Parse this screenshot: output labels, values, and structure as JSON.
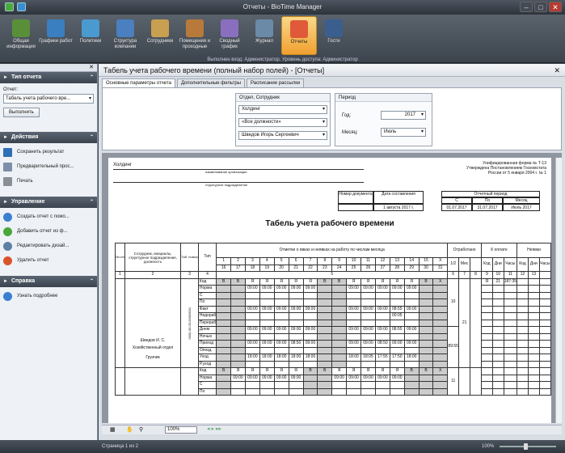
{
  "window": {
    "title": "Отчеты - BioTime Manager"
  },
  "ribbon": {
    "items": [
      "Общая информация",
      "Графики работ",
      "Политики",
      "Структура компании",
      "Сотрудники",
      "Помещения и проходные",
      "Сводный график",
      "Журнал",
      "Отчеты",
      "Гости"
    ],
    "active": "Отчеты"
  },
  "statusline": "Выполнен вход: Администратор. Уровень доступа: Администратор",
  "left": {
    "report_type": {
      "title": "Тип отчета",
      "label": "Отчет:",
      "value": "Табель учета рабочего вре...",
      "button": "Выполнить"
    },
    "actions": {
      "title": "Действия",
      "items": [
        "Сохранить результат",
        "Предварительный прос...",
        "Печать"
      ]
    },
    "manage": {
      "title": "Управление",
      "items": [
        "Создать отчет с помо...",
        "Добавить отчет из ф...",
        "Редактировать дизай...",
        "Удалить отчет"
      ]
    },
    "help": {
      "title": "Справка",
      "items": [
        "Узнать подробнее"
      ]
    }
  },
  "doc": {
    "title": "Табель учета рабочего времени (полный набор полей) - [Отчеты]",
    "tabs": [
      "Основные параметры отчета",
      "Дополнительные фильтры",
      "Расписание рассылки"
    ]
  },
  "params": {
    "dept_title": "Отдел, Сотрудник",
    "company": "Холдинг",
    "position": "«Все должности»",
    "employee": "Шведов Игорь Сергеевич",
    "period_title": "Период",
    "year_label": "Год:",
    "year": "2017",
    "month_label": "Месяц:",
    "month": "Июль"
  },
  "report": {
    "org": "Холдинг",
    "org_caption": "наименование организации",
    "unit_caption": "структурное подразделение",
    "form": [
      "Унифицированная форма № Т-13",
      "Утверждена Постановлением Госкомстата",
      "России от 5 января 2004 г. № 1"
    ],
    "docnum_h": "Номер документа",
    "docdate_h": "Дата составления",
    "docdate": "1 августа 2017 г.",
    "period_h": "Отчетный период",
    "from_h": "С",
    "to_h": "По",
    "month_h": "Месяц",
    "from": "01.07.2017",
    "to": "31.07.2017",
    "month": "Июль 2017",
    "title": "Табель учета рабочего времени",
    "h_num": "№ п/п",
    "h_emp": "Сотрудник, инициалы, структурное подразделение, должность",
    "h_tab": "Таб. номер",
    "h_type": "Тип",
    "h_marks": "Отметки о явках и неявках на работу по числам месяца",
    "h_worked": "Отработано",
    "h_pay": "К оплате",
    "h_abs": "Неявки",
    "h_half": "1/2",
    "h_mes": "Мес",
    "h_code": "Код",
    "h_days": "Дни",
    "h_hours": "Часы",
    "days1": [
      "1",
      "2",
      "3",
      "4",
      "5",
      "6",
      "7",
      "8",
      "9",
      "10",
      "11",
      "12",
      "13",
      "14",
      "15"
    ],
    "days2": [
      "16",
      "17",
      "18",
      "19",
      "20",
      "21",
      "22",
      "23",
      "24",
      "25",
      "26",
      "27",
      "28",
      "29",
      "30",
      "31"
    ],
    "colnums": [
      "1",
      "2",
      "3",
      "4",
      "5",
      "6",
      "7",
      "8",
      "9",
      "10",
      "11",
      "12",
      "13"
    ],
    "rowtypes": [
      "Код",
      "Норма",
      "С",
      "По",
      "Факт",
      "Недораб",
      "Перераб",
      "Днем",
      "Ночью",
      "Приход",
      "Опозд.",
      "Уход",
      "Р.уход"
    ],
    "emp_name": "Шведов И. С.",
    "emp_dept": "Хозяйственный отдел",
    "emp_pos": "Грузчик",
    "emp_tab": "0000-00-00-00000001",
    "emp2_no": "2",
    "val_code": "Я",
    "val_off": "В",
    "val_x": "Х",
    "val_0900": "09:00",
    "val_1800": "18:00",
    "val_0850": "08:50",
    "val_0855": "08:55",
    "val_0805": "00:05",
    "val_1805": "18:05",
    "val_1755": "17:55",
    "val_1750": "17:50",
    "worked_half": "10",
    "worked_total": "21",
    "worked_hours": "89:55",
    "half2": "11",
    "pay_code": "Я",
    "pay_days": "21",
    "pay_hours": "187:35"
  },
  "toolbar": {
    "zoom": "100%"
  },
  "status": {
    "page": "Страница 1 из 2",
    "zoom": "100%"
  }
}
